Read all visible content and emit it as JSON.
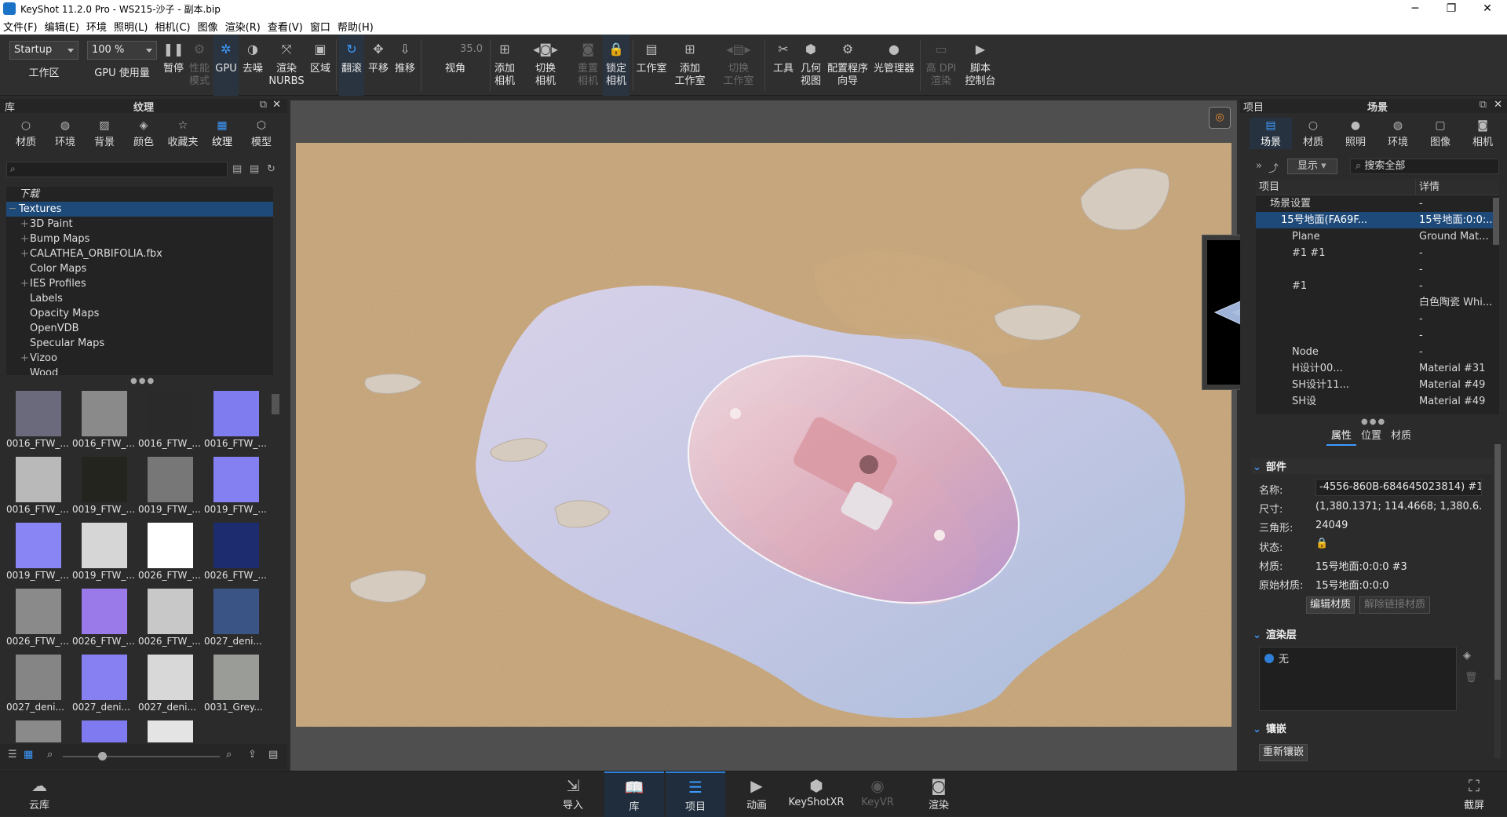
{
  "window": {
    "title": "KeyShot 11.2.0 Pro  - WS215-沙子 - 副本.bip",
    "minimize": "─",
    "maximize": "❐",
    "close": "✕"
  },
  "menu": [
    "文件(F)",
    "编辑(E)",
    "环境",
    "照明(L)",
    "相机(C)",
    "图像",
    "渲染(R)",
    "查看(V)",
    "窗口",
    "帮助(H)"
  ],
  "ribbon": {
    "workspace_value": "Startup",
    "workspace_label": "工作区",
    "zoom_value": "100 %",
    "gpu_usage": "GPU 使用量",
    "pause": "暂停",
    "perf_mode": "性能\n模式",
    "gpu": "GPU",
    "denoise": "去噪",
    "render_nurbs": "渲染\nNURBS",
    "region": "区域",
    "tumble": "翻滚",
    "pan": "平移",
    "dolly": "推移",
    "fov_value": "35.0",
    "fov_label": "视角",
    "add_camera": "添加\n相机",
    "switch_camera": "切换\n相机",
    "reset_camera": "重置\n相机",
    "lock_camera": "锁定\n相机",
    "studio": "工作室",
    "add_studio": "添加\n工作室",
    "switch_studio": "切换\n工作室",
    "tools": "工具",
    "geometry_view": "几何\n视图",
    "config_wizard": "配置程序\n向导",
    "light_manager": "光管理器",
    "hi_dpi": "高 DPI\n渲染",
    "script_console": "脚本\n控制台"
  },
  "library": {
    "panel_label": "库",
    "panel_title": "纹理",
    "tabs": [
      "材质",
      "环境",
      "背景",
      "颜色",
      "收藏夹",
      "纹理",
      "模型"
    ],
    "active_tab": "纹理",
    "tree": [
      {
        "label": "下载",
        "indent": 0,
        "expander": "",
        "italic": true
      },
      {
        "label": "Textures",
        "indent": 0,
        "expander": "─",
        "selected": true
      },
      {
        "label": "3D Paint",
        "indent": 1,
        "expander": "+"
      },
      {
        "label": "Bump Maps",
        "indent": 1,
        "expander": "+"
      },
      {
        "label": "CALATHEA_ORBIFOLIA.fbx",
        "indent": 1,
        "expander": "+"
      },
      {
        "label": "Color Maps",
        "indent": 1,
        "expander": ""
      },
      {
        "label": "IES Profiles",
        "indent": 1,
        "expander": "+"
      },
      {
        "label": "Labels",
        "indent": 1,
        "expander": ""
      },
      {
        "label": "Opacity Maps",
        "indent": 1,
        "expander": ""
      },
      {
        "label": "OpenVDB",
        "indent": 1,
        "expander": ""
      },
      {
        "label": "Specular Maps",
        "indent": 1,
        "expander": ""
      },
      {
        "label": "Vizoo",
        "indent": 1,
        "expander": "+"
      },
      {
        "label": "Wood",
        "indent": 1,
        "expander": ""
      }
    ],
    "thumbnails": [
      {
        "label": "0016_FTW_...",
        "color": "#6b6a7c"
      },
      {
        "label": "0016_FTW_...",
        "color": "#8a8a8a"
      },
      {
        "label": "0016_FTW_...",
        "color": "#2a2a2a"
      },
      {
        "label": "0016_FTW_...",
        "color": "#7f7cf0"
      },
      {
        "label": "0016_FTW_...",
        "color": "#b9b9b9"
      },
      {
        "label": "0019_FTW_...",
        "color": "#24241f"
      },
      {
        "label": "0019_FTW_...",
        "color": "#777777"
      },
      {
        "label": "0019_FTW_...",
        "color": "#8580f2"
      },
      {
        "label": "0019_FTW_...",
        "color": "#8a85f5"
      },
      {
        "label": "0019_FTW_...",
        "color": "#d6d6d6"
      },
      {
        "label": "0026_FTW_...",
        "color": "#ffffff"
      },
      {
        "label": "0026_FTW_...",
        "color": "#1c2c6e"
      },
      {
        "label": "0026_FTW_...",
        "color": "#8a8a8a"
      },
      {
        "label": "0026_FTW_...",
        "color": "#9a7ae8"
      },
      {
        "label": "0026_FTW_...",
        "color": "#c8c8c8"
      },
      {
        "label": "0027_deni...",
        "color": "#3a5585"
      },
      {
        "label": "0027_deni...",
        "color": "#858585"
      },
      {
        "label": "0027_deni...",
        "color": "#8680f2"
      },
      {
        "label": "0027_deni...",
        "color": "#d8d8d8"
      },
      {
        "label": "0031_Grey...",
        "color": "#9a9c98"
      },
      {
        "label": "",
        "color": "#8a8a8a"
      },
      {
        "label": "",
        "color": "#807af0"
      },
      {
        "label": "",
        "color": "#e4e4e4"
      },
      {
        "label": "",
        "color": "#2b2b2b"
      }
    ]
  },
  "project": {
    "panel_label": "项目",
    "panel_title": "场景",
    "tabs": [
      "场景",
      "材质",
      "照明",
      "环境",
      "图像",
      "相机"
    ],
    "active_tab": "场景",
    "show_label": "显示",
    "search_placeholder": "搜索全部",
    "col_item": "项目",
    "col_detail": "详情",
    "rows": [
      {
        "c1": "场景设置",
        "c2": "-",
        "indent": 1
      },
      {
        "c1": "15号地面(FA69F...",
        "c2": "15号地面:0:0:...",
        "indent": 2,
        "selected": true
      },
      {
        "c1": "Plane",
        "c2": "Ground Mat...",
        "indent": 3
      },
      {
        "c1": "#1 #1",
        "c2": "-",
        "indent": 3
      },
      {
        "c1": "",
        "c2": "-",
        "indent": 3
      },
      {
        "c1": "#1",
        "c2": "-",
        "indent": 3
      },
      {
        "c1": "",
        "c2": "白色陶瓷 Whi...",
        "indent": 3
      },
      {
        "c1": "",
        "c2": "-",
        "indent": 3
      },
      {
        "c1": "",
        "c2": "-",
        "indent": 3
      },
      {
        "c1": "Node",
        "c2": "-",
        "indent": 3
      },
      {
        "c1": "H设计00...",
        "c2": "Material #31",
        "indent": 3
      },
      {
        "c1": "SH设计11...",
        "c2": "Material #49",
        "indent": 3
      },
      {
        "c1": "SH设",
        "c2": "Material #49",
        "indent": 3
      }
    ],
    "subtabs": [
      "属性",
      "位置",
      "材质"
    ],
    "active_subtab": "属性",
    "part_section": "部件",
    "name_label": "名称:",
    "name_value": "-4556-860B-684645023814) #1",
    "size_label": "尺寸:",
    "size_value": "(1,380.1371; 114.4668; 1,380.6...",
    "tris_label": "三角形:",
    "tris_value": "24049",
    "state_label": "状态:",
    "material_label": "材质:",
    "material_value": "15号地面:0:0:0 #3",
    "orig_material_label": "原始材质:",
    "orig_material_value": "15号地面:0:0:0",
    "edit_material": "编辑材质",
    "unlink_material": "解除链接材质",
    "render_layer_section": "渲染层",
    "render_layer_value": "无",
    "inlay_section": "镶嵌",
    "reinlay": "重新镶嵌"
  },
  "bottom": {
    "cloud": "云库",
    "import": "导入",
    "library": "库",
    "project": "项目",
    "animation": "动画",
    "keyshotxr": "KeyShotXR",
    "keyvr": "KeyVR",
    "render": "渲染",
    "screenshot": "截屏"
  },
  "colors": {
    "accent": "#3d9bff",
    "selection": "#1e4a7a"
  }
}
